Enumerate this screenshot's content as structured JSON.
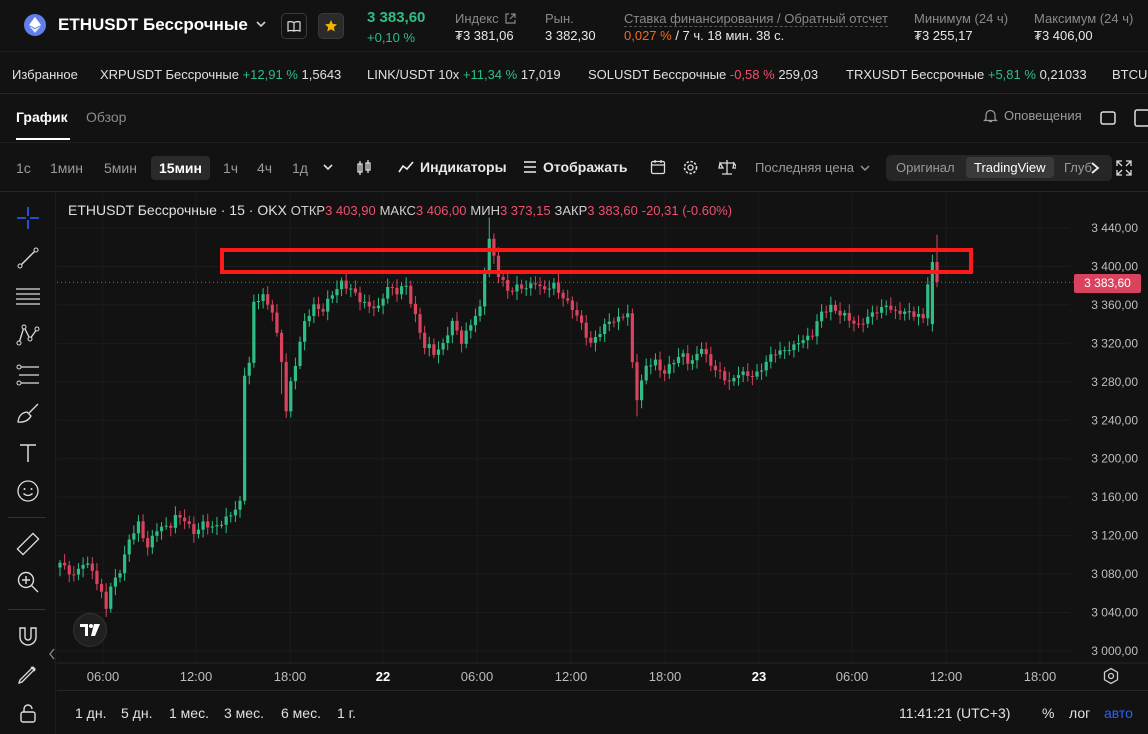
{
  "header": {
    "symbol": "ETHUSDT Бессрочные",
    "last_price": "3 383,60",
    "change_pct": "+0,10 %",
    "index_label": "Индекс",
    "index_value": "₮3 381,06",
    "market_label": "Рын.",
    "market_value": "3 382,30",
    "funding_label": "Ставка финансирования / Обратный отсчет",
    "funding_rate": "0,027 %",
    "funding_countdown": " / 7 ч. 18 мин. 38 с.",
    "low24_label": "Минимум (24 ч)",
    "low24_value": "₮3 255,17",
    "high24_label": "Максимум (24 ч)",
    "high24_value": "₮3 406,00"
  },
  "ticker": {
    "favorites_label": "Избранное",
    "items": [
      {
        "name": "XRPUSDT Бессрочные",
        "change": "+12,91 %",
        "price": "1,5643",
        "dir": "up"
      },
      {
        "name": "LINK/USDT 10x",
        "change": "+11,34 %",
        "price": "17,019",
        "dir": "up"
      },
      {
        "name": "SOLUSDT Бессрочные",
        "change": "-0,58 %",
        "price": "259,03",
        "dir": "down"
      },
      {
        "name": "TRXUSDT Бессрочные",
        "change": "+5,81 %",
        "price": "0,21033",
        "dir": "up"
      },
      {
        "name": "BTCUSDT",
        "change": "",
        "price": "",
        "dir": "up"
      }
    ]
  },
  "tabs": {
    "chart": "График",
    "overview": "Обзор",
    "alerts": "Оповещения"
  },
  "toolbar": {
    "timeframes": [
      "1с",
      "1мин",
      "5мин",
      "15мин",
      "1ч",
      "4ч",
      "1д"
    ],
    "active_timeframe": "15мин",
    "indicators": "Индикаторы",
    "display": "Отображать",
    "price_type": "Последняя цена",
    "view_original": "Оригинал",
    "view_tradingview": "TradingView",
    "view_depth": "Глуб"
  },
  "legend": {
    "title": "ETHUSDT Бессрочные · 15 · OKX",
    "open_label": "ОТКР",
    "open": "3 403,90",
    "high_label": "МАКС",
    "high": "3 406,00",
    "low_label": "МИН",
    "low": "3 373,15",
    "close_label": "ЗАКР",
    "close": "3 383,60",
    "change": "-20,31 (-0.60%)"
  },
  "current_price_tag": "3 383,60",
  "colors": {
    "up": "#2ebd85",
    "down": "#d9435e",
    "highlight_box": "#ff1a1a",
    "background": "#121212"
  },
  "chart_data": {
    "type": "candlestick",
    "y_ticks": [
      "3 440,00",
      "3 400,00",
      "3 360,00",
      "3 320,00",
      "3 280,00",
      "3 240,00",
      "3 200,00",
      "3 160,00",
      "3 120,00",
      "3 080,00",
      "3 040,00",
      "3 000,00"
    ],
    "x_ticks": [
      "06:00",
      "12:00",
      "18:00",
      "22",
      "06:00",
      "12:00",
      "18:00",
      "23",
      "06:00",
      "12:00",
      "18:00"
    ],
    "x_ticks_bold": [
      "22",
      "23"
    ],
    "ylim": [
      2995,
      3455
    ],
    "anchors": [
      [
        0,
        3090
      ],
      [
        3,
        3080
      ],
      [
        5,
        3090
      ],
      [
        7,
        3085
      ],
      [
        9,
        3060
      ],
      [
        10,
        3045
      ],
      [
        11,
        3065
      ],
      [
        13,
        3085
      ],
      [
        15,
        3115
      ],
      [
        17,
        3130
      ],
      [
        19,
        3110
      ],
      [
        21,
        3125
      ],
      [
        23,
        3130
      ],
      [
        25,
        3140
      ],
      [
        27,
        3135
      ],
      [
        29,
        3125
      ],
      [
        31,
        3130
      ],
      [
        33,
        3128
      ],
      [
        35,
        3135
      ],
      [
        37,
        3140
      ],
      [
        39,
        3155
      ],
      [
        40,
        3290
      ],
      [
        41,
        3300
      ],
      [
        42,
        3360
      ],
      [
        44,
        3370
      ],
      [
        46,
        3355
      ],
      [
        48,
        3300
      ],
      [
        49,
        3250
      ],
      [
        50,
        3280
      ],
      [
        51,
        3300
      ],
      [
        53,
        3340
      ],
      [
        55,
        3360
      ],
      [
        57,
        3355
      ],
      [
        59,
        3370
      ],
      [
        61,
        3385
      ],
      [
        63,
        3375
      ],
      [
        65,
        3365
      ],
      [
        67,
        3360
      ],
      [
        69,
        3355
      ],
      [
        71,
        3380
      ],
      [
        73,
        3375
      ],
      [
        75,
        3378
      ],
      [
        77,
        3350
      ],
      [
        79,
        3315
      ],
      [
        81,
        3310
      ],
      [
        83,
        3320
      ],
      [
        85,
        3340
      ],
      [
        87,
        3325
      ],
      [
        89,
        3340
      ],
      [
        91,
        3355
      ],
      [
        92,
        3395
      ],
      [
        93,
        3430
      ],
      [
        95,
        3390
      ],
      [
        97,
        3375
      ],
      [
        99,
        3380
      ],
      [
        101,
        3375
      ],
      [
        103,
        3385
      ],
      [
        105,
        3375
      ],
      [
        107,
        3380
      ],
      [
        109,
        3370
      ],
      [
        111,
        3355
      ],
      [
        113,
        3340
      ],
      [
        115,
        3320
      ],
      [
        117,
        3330
      ],
      [
        119,
        3345
      ],
      [
        121,
        3345
      ],
      [
        123,
        3350
      ],
      [
        124,
        3300
      ],
      [
        125,
        3265
      ],
      [
        127,
        3295
      ],
      [
        129,
        3300
      ],
      [
        131,
        3290
      ],
      [
        133,
        3300
      ],
      [
        135,
        3310
      ],
      [
        137,
        3300
      ],
      [
        139,
        3315
      ],
      [
        141,
        3300
      ],
      [
        143,
        3285
      ],
      [
        145,
        3280
      ],
      [
        147,
        3290
      ],
      [
        149,
        3285
      ],
      [
        151,
        3290
      ],
      [
        153,
        3300
      ],
      [
        155,
        3310
      ],
      [
        157,
        3315
      ],
      [
        159,
        3315
      ],
      [
        161,
        3325
      ],
      [
        163,
        3330
      ],
      [
        165,
        3350
      ],
      [
        167,
        3360
      ],
      [
        169,
        3350
      ],
      [
        171,
        3345
      ],
      [
        173,
        3340
      ],
      [
        175,
        3345
      ],
      [
        177,
        3355
      ],
      [
        179,
        3360
      ],
      [
        181,
        3350
      ],
      [
        183,
        3355
      ],
      [
        185,
        3350
      ],
      [
        187,
        3345
      ],
      [
        188,
        3385
      ],
      [
        189,
        3404
      ],
      [
        190,
        3384
      ]
    ]
  },
  "bottom": {
    "ranges": [
      "1 дн.",
      "5 дн.",
      "1 мес.",
      "3 мес.",
      "6 мес.",
      "1 г."
    ],
    "clock": "11:41:21 (UTC+3)",
    "percent": "%",
    "log": "лог",
    "auto": "авто"
  }
}
